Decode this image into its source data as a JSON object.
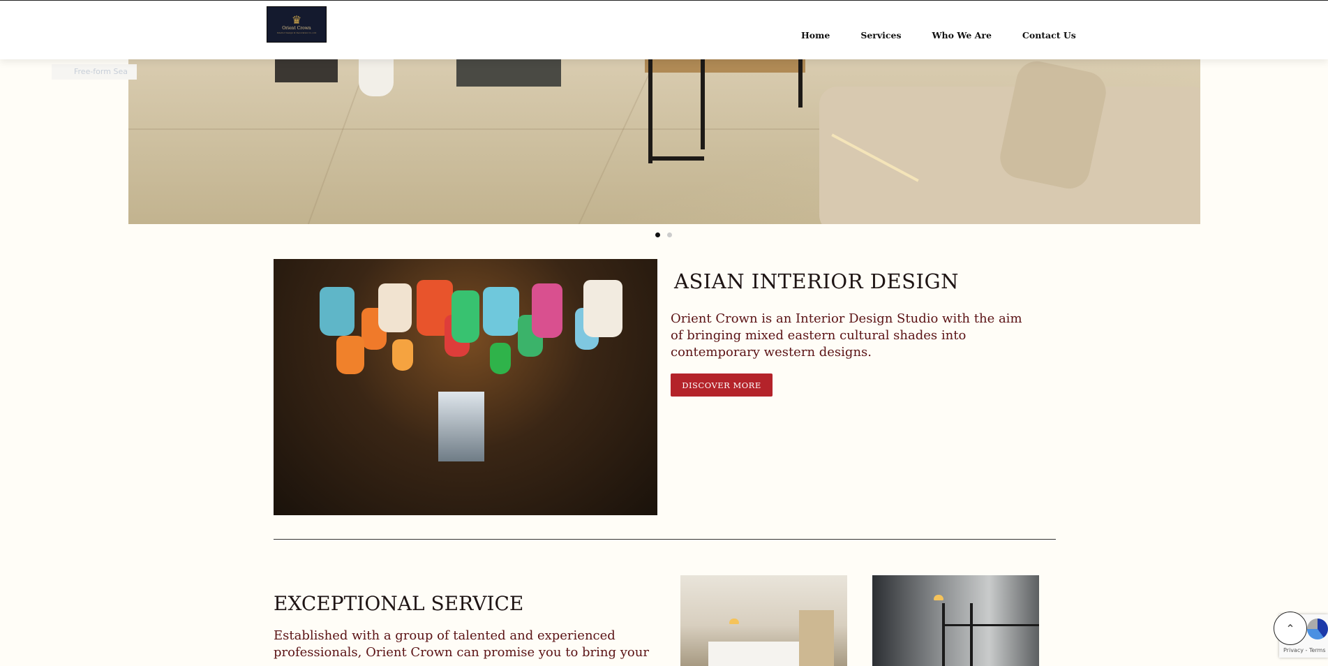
{
  "header": {
    "logo": {
      "brand": "Orient Crown",
      "tagline": "Interior Design & Decoration Co.,Ltd"
    },
    "nav": [
      {
        "label": "Home"
      },
      {
        "label": "Services"
      },
      {
        "label": "Who We Are"
      },
      {
        "label": "Contact Us"
      }
    ]
  },
  "overlay_text": "Free-form Sea",
  "slider": {
    "dots": 2,
    "active": 1
  },
  "feature": {
    "title": "ASIAN INTERIOR DESIGN",
    "text": "Orient Crown is an Interior Design Studio with the aim of bringing mixed eastern cultural shades into contemporary western designs.",
    "button": "DISCOVER MORE"
  },
  "service": {
    "title": "EXCEPTIONAL SERVICE",
    "text": "Established with a group of talented and experienced professionals, Orient Crown can promise you to bring your"
  },
  "recaptcha": {
    "terms": "Privacy - Terms"
  },
  "colors": {
    "accent": "#b4232a",
    "text_red": "#5a1214"
  }
}
